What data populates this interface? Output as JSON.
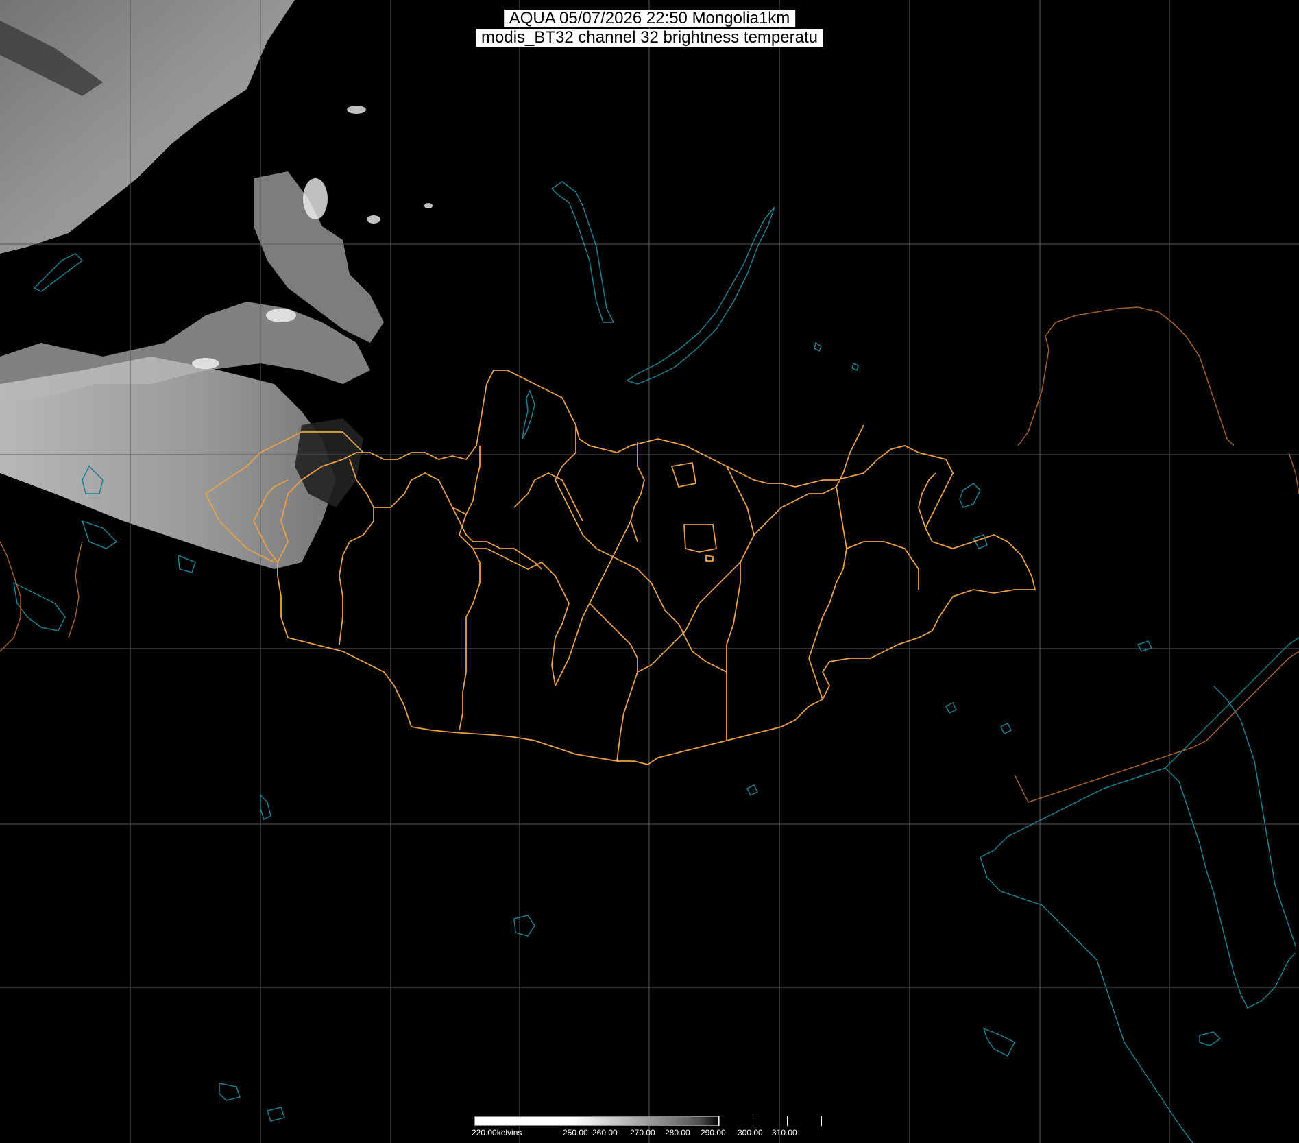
{
  "header": {
    "title_line_1": "AQUA 05/07/2026 22:50 Mongolia1km",
    "title_line_2": "modis_BT32 channel 32 brightness temperatu"
  },
  "colorbar": {
    "labels": [
      "220.00kelvins",
      "250.00",
      "260.00",
      "270.00",
      "280.00",
      "290.00",
      "300.00",
      "310.00"
    ],
    "gradient_from": "#ffffff",
    "gradient_to": "#000000"
  },
  "colors": {
    "background": "#000000",
    "grid": "#5a5a5a",
    "admin_borders": "#e8a04a",
    "national_borders": "#a0622d",
    "water_coastlines": "#1f7f8f",
    "cloud_imagery": "#c8c8c8"
  }
}
